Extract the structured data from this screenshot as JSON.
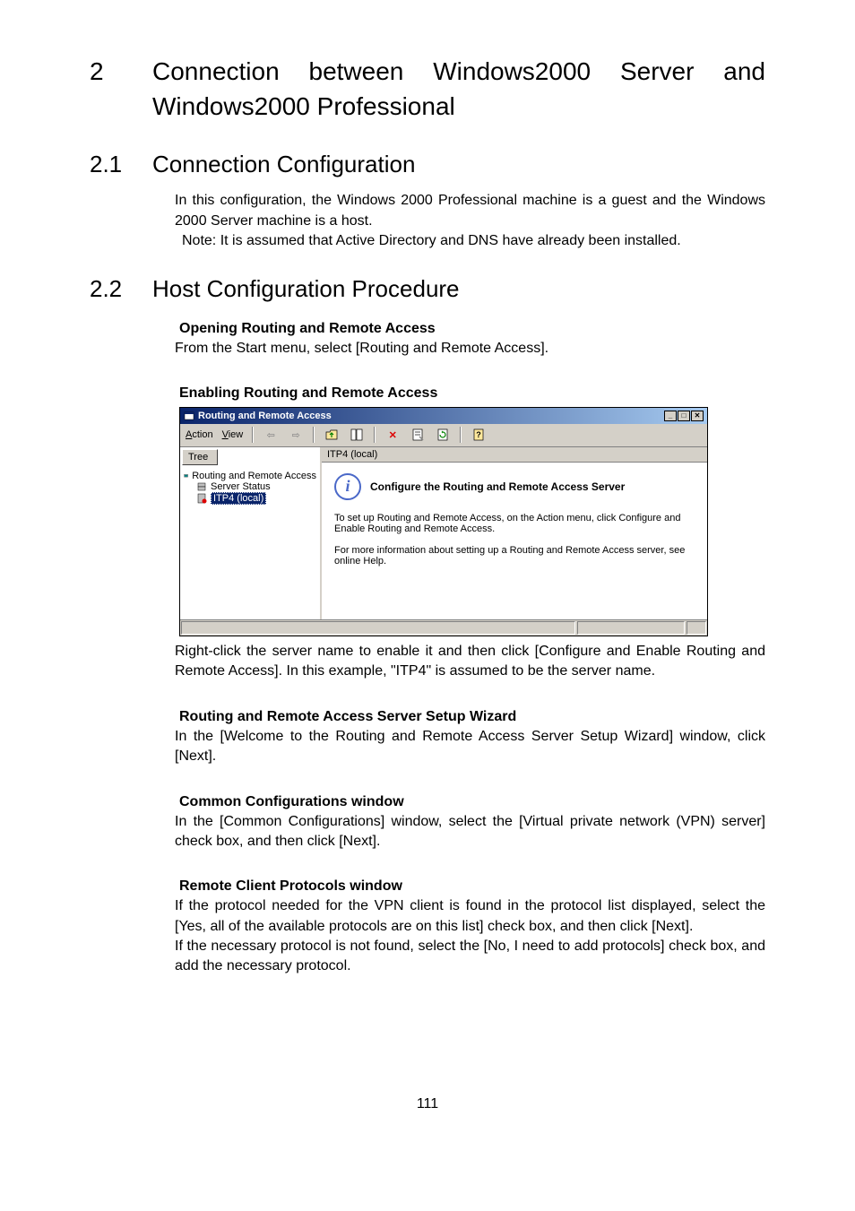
{
  "headings": {
    "h1_num": "2",
    "h1_line1": "Connection between Windows2000 Server and",
    "h1_line2": "Windows2000 Professional",
    "h21_num": "2.1",
    "h21_text": "Connection Configuration",
    "h22_num": "2.2",
    "h22_text": "Host Configuration Procedure"
  },
  "sec21": {
    "p1": "In this configuration, the Windows 2000 Professional machine is a guest and the Windows 2000 Server machine is a host.",
    "note": "Note:    It is assumed that Active Directory and DNS have already been installed."
  },
  "sec22": {
    "sub1_title": "Opening Routing and Remote Access",
    "sub1_body": "From the Start menu, select [Routing and Remote Access].",
    "sub2_title": "Enabling Routing and Remote Access",
    "sub2_after": "Right-click the server name to enable it and then click [Configure and Enable Routing and Remote Access].    In this example, \"ITP4\" is assumed to be the server name.",
    "sub3_title": "Routing and Remote Access Server Setup Wizard",
    "sub3_body": "In the [Welcome to the Routing and Remote Access Server Setup Wizard] window, click [Next].",
    "sub4_title": "Common Configurations window",
    "sub4_body": "In the [Common Configurations] window, select the [Virtual private network (VPN) server] check box, and then click [Next].",
    "sub5_title": "Remote Client Protocols window",
    "sub5_body1": "If the protocol needed for the VPN client is found in the protocol list displayed, select the [Yes, all of the available protocols are on this list] check box, and then click [Next].",
    "sub5_body2": "If the necessary protocol is not found, select the [No, I need to add protocols] check box, and add the necessary protocol."
  },
  "mmc": {
    "title": "Routing and Remote Access",
    "menu_action": "Action",
    "menu_view": "View",
    "tree_header": "Tree",
    "node_root": "Routing and Remote Access",
    "node_status": "Server Status",
    "node_server": "ITP4 (local)",
    "right_header": "ITP4 (local)",
    "info_title": "Configure the Routing and Remote Access Server",
    "info_p1": "To set up Routing and Remote Access, on the Action menu, click Configure and Enable Routing and Remote Access.",
    "info_p2": "For more information about setting up a Routing and Remote Access server, see online Help."
  },
  "page_number": "111"
}
